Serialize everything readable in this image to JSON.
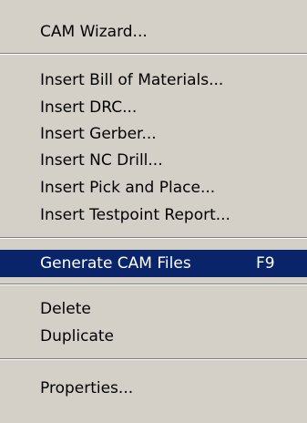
{
  "menu": {
    "cam_wizard": "CAM Wizard...",
    "insert_bom": "Insert Bill of Materials...",
    "insert_drc": "Insert DRC...",
    "insert_gerber": "Insert Gerber...",
    "insert_nc_drill": "Insert NC Drill...",
    "insert_pick_place": "Insert Pick and Place...",
    "insert_testpoint": "Insert Testpoint Report...",
    "generate_cam": "Generate CAM Files",
    "generate_cam_shortcut": "F9",
    "delete": "Delete",
    "duplicate": "Duplicate",
    "properties": "Properties..."
  },
  "colors": {
    "menu_background": "#d4d0c8",
    "highlight_background": "#0a246a",
    "highlight_text": "#ffffff"
  }
}
